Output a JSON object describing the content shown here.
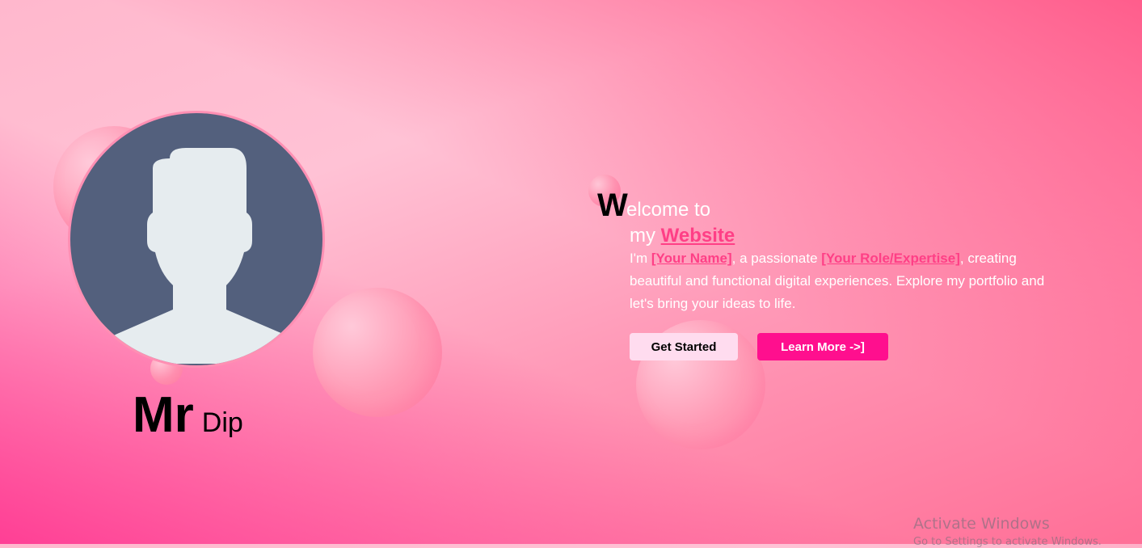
{
  "profile": {
    "first_name": "Mr",
    "last_name": "Dip",
    "avatar_icon": "user-silhouette-icon"
  },
  "hero": {
    "big_letter": "W",
    "line1": "elcome to",
    "line2_prefix": "my ",
    "line2_link": "Website",
    "desc_part1": "I'm ",
    "desc_name": "[Your Name]",
    "desc_part2": ", a passionate ",
    "desc_role": "[Your Role/Expertise]",
    "desc_part3": ", creating beautiful and functional digital experiences. Explore my portfolio and let's bring your ideas to life."
  },
  "buttons": {
    "get_started": "Get Started",
    "learn_more": "Learn More ->]"
  },
  "watermark": {
    "title": "Activate Windows",
    "subtitle": "Go to Settings to activate Windows."
  },
  "colors": {
    "accent": "#ff3f86",
    "primary_button": "#ffdcef",
    "secondary_button": "#ff0f8e",
    "avatar_bg": "#53607d"
  }
}
